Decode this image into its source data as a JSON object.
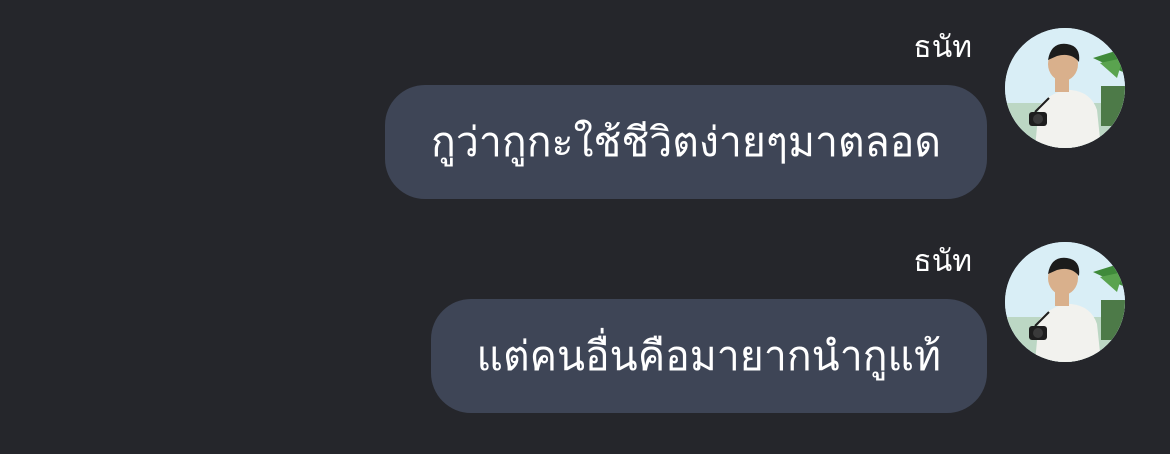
{
  "chat": {
    "messages": [
      {
        "sender": "ธนัท",
        "text": "กูว่ากูกะใช้ชีวิตง่ายๆมาตลอด",
        "avatar_icon": "profile-photo-man-with-camera"
      },
      {
        "sender": "ธนัท",
        "text": "แต่คนอื่นคือมายากนำกูแท้",
        "avatar_icon": "profile-photo-man-with-camera"
      }
    ]
  },
  "colors": {
    "background": "#25262b",
    "bubble": "#3e4556",
    "text": "#ffffff"
  }
}
